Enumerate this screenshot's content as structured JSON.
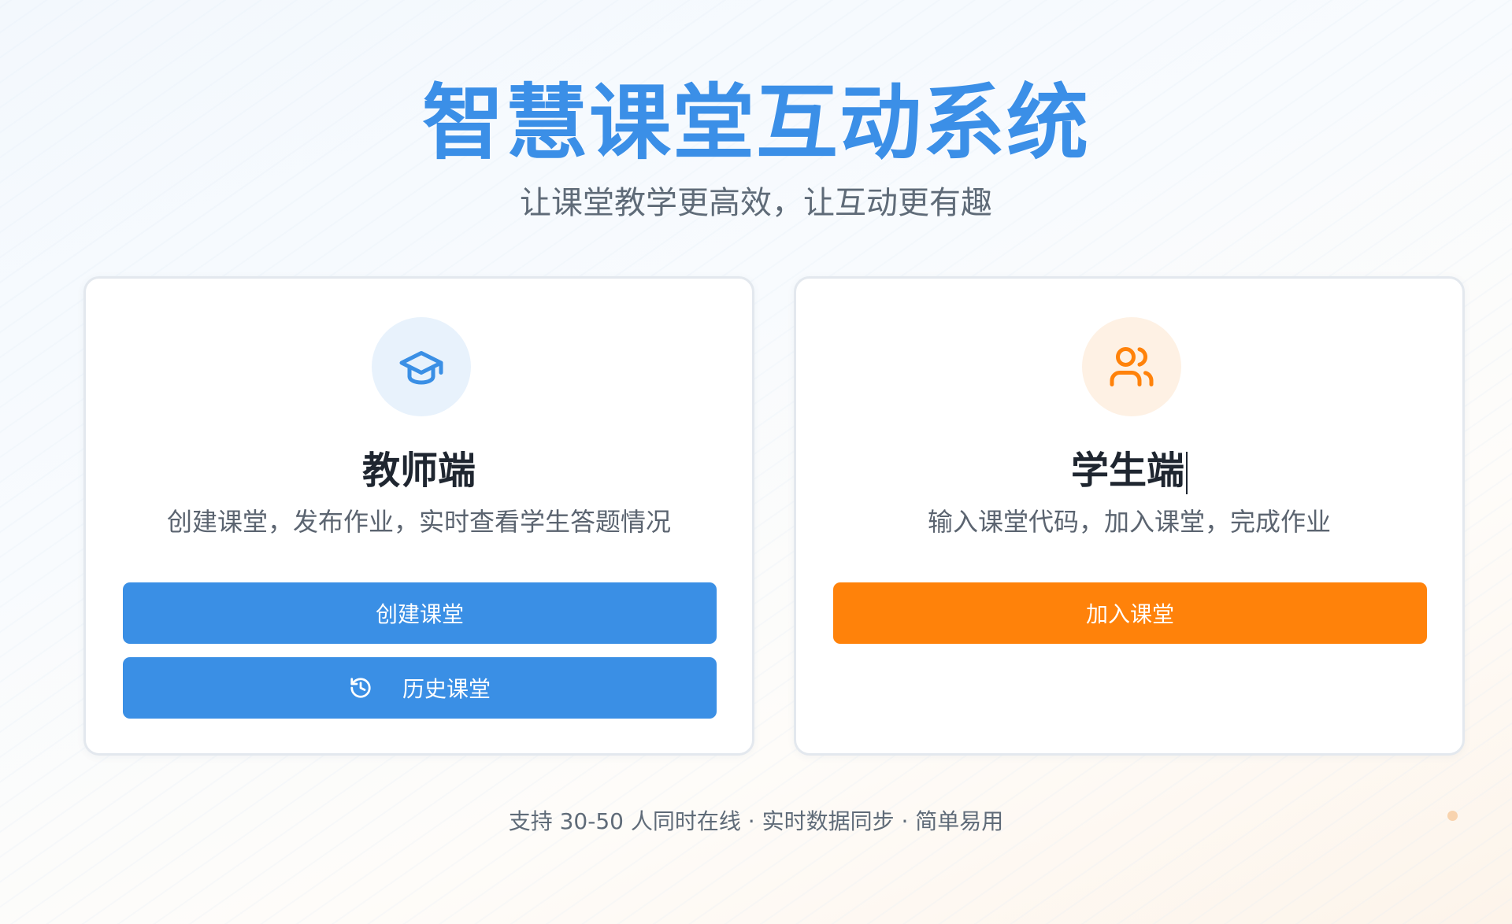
{
  "app": {
    "title": "智慧课堂互动系统",
    "subtitle": "让课堂教学更高效，让互动更有趣"
  },
  "teacher": {
    "icon": "graduation-cap-icon",
    "title": "教师端",
    "description": "创建课堂，发布作业，实时查看学生答题情况",
    "create_button_label": "创建课堂",
    "history_button_label": "历史课堂",
    "history_icon": "history-icon"
  },
  "student": {
    "icon": "users-icon",
    "title": "学生端",
    "description": "输入课堂代码，加入课堂，完成作业",
    "join_button_label": "加入课堂"
  },
  "footer": {
    "text": "支持 30-50 人同时在线 · 实时数据同步 · 简单易用"
  },
  "colors": {
    "accent_blue": "#3a8fe5",
    "accent_orange": "#ff820a",
    "title_blue": "#3b8fe7"
  }
}
